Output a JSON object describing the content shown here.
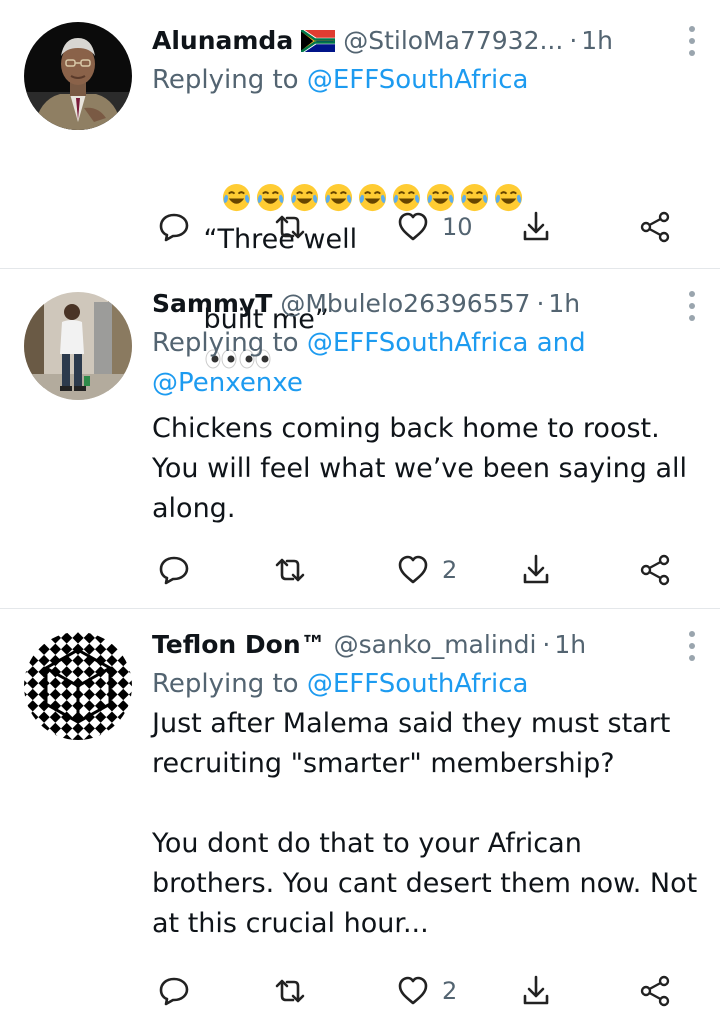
{
  "tweets": [
    {
      "display_name": "Alunamda",
      "flag_icon": "south-africa-flag-icon",
      "handle": "@StiloMa77932...",
      "separator": "·",
      "time": "1h",
      "reply_prefix": "Replying to",
      "mentions": [
        "@EFFSouthAfrica"
      ],
      "emoji_icon": "face-with-tears-of-joy-icon",
      "emoji_count": 9,
      "text_line1": "“Three well",
      "text_line2": "built me”",
      "trailing_icon": "eyes-icon",
      "likes": "10"
    },
    {
      "display_name": "SammyT",
      "handle": "@Mbulelo26396557",
      "separator": "·",
      "time": "1h",
      "reply_prefix": "Replying to",
      "mentions": [
        "@EFFSouthAfrica",
        "@Penxenxe"
      ],
      "mention_joiner": "and",
      "text": "Chickens coming back home to roost.\nYou will feel what we’ve been saying all\nalong.",
      "likes": "2"
    },
    {
      "display_name": "Teflon Don™",
      "handle": "@sanko_malindi",
      "separator": "·",
      "time": "1h",
      "reply_prefix": "Replying to",
      "mentions": [
        "@EFFSouthAfrica"
      ],
      "text": "Just after Malema said they must start\nrecruiting \"smarter\" membership?\n\nYou dont do that to your African\nbrothers. You cant desert them now. Not\nat this crucial hour...",
      "likes": "2"
    }
  ],
  "colors": {
    "text": "#0f1419",
    "secondary": "#536471",
    "link": "#1d9bf0",
    "divider": "#e4e7ea"
  },
  "icons": {
    "reply": "reply-icon",
    "retweet": "retweet-icon",
    "like": "heart-icon",
    "bookmark": "bookmark-icon",
    "share": "share-icon",
    "more": "more-vertical-icon"
  }
}
